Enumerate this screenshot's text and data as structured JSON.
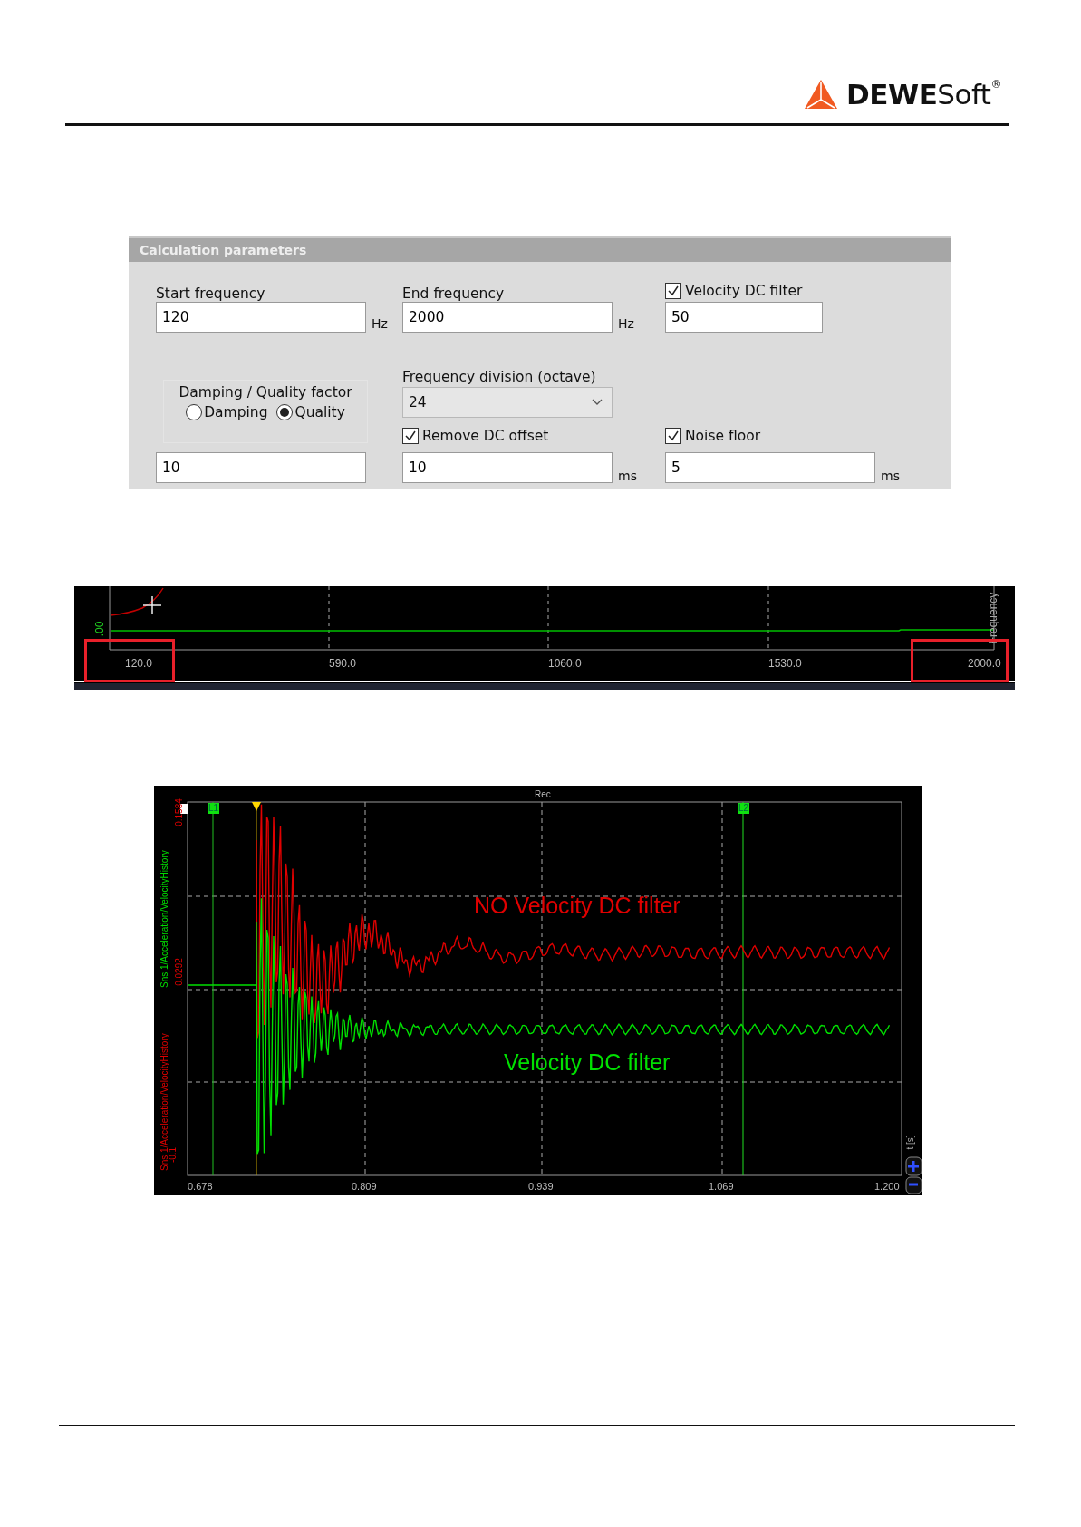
{
  "header": {
    "logo": "**DEWE**Soft$^{®}$"
  },
  "panel": {
    "title": "Calculation parameters",
    "start_frequency": {
      "label": "Start frequency",
      "value": "120",
      "unit": "Hz"
    },
    "end_frequency": {
      "label": "End frequency",
      "value": "2000",
      "unit": "Hz"
    },
    "velocity_dc_filter": {
      "label": "Velocity DC filter",
      "checked": true,
      "value": "50"
    },
    "frequency_division": {
      "label": "Frequency division (octave)",
      "value": "24"
    },
    "damping_group": {
      "title": "Damping / Quality factor",
      "options": [
        {
          "label": "Damping",
          "selected": false
        },
        {
          "label": "Quality",
          "selected": true
        }
      ],
      "value": "10"
    },
    "remove_dc_offset": {
      "label": "Remove DC offset",
      "checked": true,
      "value": "10",
      "unit": "ms"
    },
    "noise_floor": {
      "label": "Noise floor",
      "checked": true,
      "value": "5",
      "unit": "ms"
    }
  },
  "frequency_plot": {
    "y_tick": ".00",
    "axis_title": "Frequency",
    "x_ticks": [
      {
        "label": "120.0",
        "highlighted": true
      },
      {
        "label": "590.0",
        "highlighted": false
      },
      {
        "label": "1060.0",
        "highlighted": false
      },
      {
        "label": "1530.0",
        "highlighted": false
      },
      {
        "label": "2000.0",
        "highlighted": true
      }
    ]
  },
  "time_plot": {
    "title": "Rec",
    "markers": [
      "L1",
      "L2"
    ],
    "y_ticks": [
      "0.1584",
      "0.0292",
      "-0.1"
    ],
    "traces": [
      {
        "axis_title": "Sns 1/Acceleration/VelocityHistory",
        "color": "#e00000",
        "annotation": "NO Velocity DC filter"
      },
      {
        "axis_title": "Sns 1/Acceleration/VelocityHistory",
        "color": "#00e000",
        "annotation": "Velocity DC filter"
      }
    ],
    "x_ticks": [
      "0.678",
      "0.809",
      "0.939",
      "1.069",
      "1.200"
    ],
    "x_axis_title": "t [s]"
  }
}
